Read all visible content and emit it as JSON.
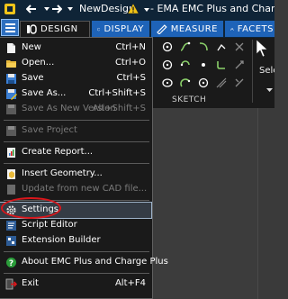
{
  "titlebar": {
    "doc_name": "NewDesign",
    "app_title": "- EMA EMC Plus and Charge Plus"
  },
  "tabs": [
    {
      "label": "DESIGN"
    },
    {
      "label": "DISPLAY"
    },
    {
      "label": "MEASURE"
    },
    {
      "label": "FACETS"
    }
  ],
  "ribbon": {
    "group_sketch": "SKETCH",
    "select_label": "Sele"
  },
  "menu": {
    "items": [
      {
        "label": "New",
        "shortcut": "Ctrl+N",
        "enabled": true,
        "icon": "new-file-icon"
      },
      {
        "label": "Open...",
        "shortcut": "Ctrl+O",
        "enabled": true,
        "icon": "open-folder-icon"
      },
      {
        "label": "Save",
        "shortcut": "Ctrl+S",
        "enabled": true,
        "icon": "save-icon"
      },
      {
        "label": "Save As...",
        "shortcut": "Ctrl+Shift+S",
        "enabled": true,
        "icon": "save-as-icon"
      },
      {
        "label": "Save As New Version",
        "shortcut": "Alt+Shift+S",
        "enabled": false,
        "icon": "save-version-icon"
      },
      {
        "label": "Save Project",
        "shortcut": "",
        "enabled": false,
        "icon": "save-project-icon"
      },
      {
        "label": "Create Report...",
        "shortcut": "",
        "enabled": true,
        "icon": "report-icon"
      },
      {
        "label": "Insert Geometry...",
        "shortcut": "",
        "enabled": true,
        "icon": "insert-geometry-icon"
      },
      {
        "label": "Update from new CAD file...",
        "shortcut": "",
        "enabled": false,
        "icon": "update-cad-icon"
      },
      {
        "label": "Settings",
        "shortcut": "",
        "enabled": true,
        "icon": "gear-icon"
      },
      {
        "label": "Script Editor",
        "shortcut": "",
        "enabled": true,
        "icon": "script-editor-icon"
      },
      {
        "label": "Extension Builder",
        "shortcut": "",
        "enabled": true,
        "icon": "extension-builder-icon"
      },
      {
        "label": "About EMC Plus and Charge Plus",
        "shortcut": "",
        "enabled": true,
        "icon": "help-icon"
      },
      {
        "label": "Exit",
        "shortcut": "Alt+F4",
        "enabled": true,
        "icon": "exit-icon"
      }
    ]
  },
  "colors": {
    "accent": "#1e63b8",
    "highlight_circle": "#d9161b"
  }
}
